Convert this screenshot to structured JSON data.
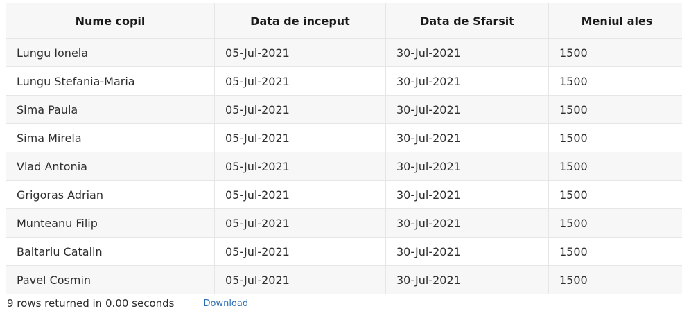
{
  "table": {
    "columns": [
      "Nume copil",
      "Data de inceput",
      "Data de Sfarsit",
      "Meniul ales"
    ],
    "rows": [
      [
        "Lungu Ionela",
        "05-Jul-2021",
        "30-Jul-2021",
        "1500"
      ],
      [
        "Lungu Stefania-Maria",
        "05-Jul-2021",
        "30-Jul-2021",
        "1500"
      ],
      [
        "Sima Paula",
        "05-Jul-2021",
        "30-Jul-2021",
        "1500"
      ],
      [
        "Sima Mirela",
        "05-Jul-2021",
        "30-Jul-2021",
        "1500"
      ],
      [
        "Vlad Antonia",
        "05-Jul-2021",
        "30-Jul-2021",
        "1500"
      ],
      [
        "Grigoras Adrian",
        "05-Jul-2021",
        "30-Jul-2021",
        "1500"
      ],
      [
        "Munteanu Filip",
        "05-Jul-2021",
        "30-Jul-2021",
        "1500"
      ],
      [
        "Baltariu Catalin",
        "05-Jul-2021",
        "30-Jul-2021",
        "1500"
      ],
      [
        "Pavel Cosmin",
        "05-Jul-2021",
        "30-Jul-2021",
        "1500"
      ]
    ]
  },
  "footer": {
    "summary": "9 rows returned in 0.00 seconds",
    "download_label": "Download"
  },
  "colors": {
    "header_bg": "#f7f7f7",
    "stripe_bg": "#f7f7f7",
    "border": "#e6e6e6",
    "link": "#2a6db5"
  }
}
